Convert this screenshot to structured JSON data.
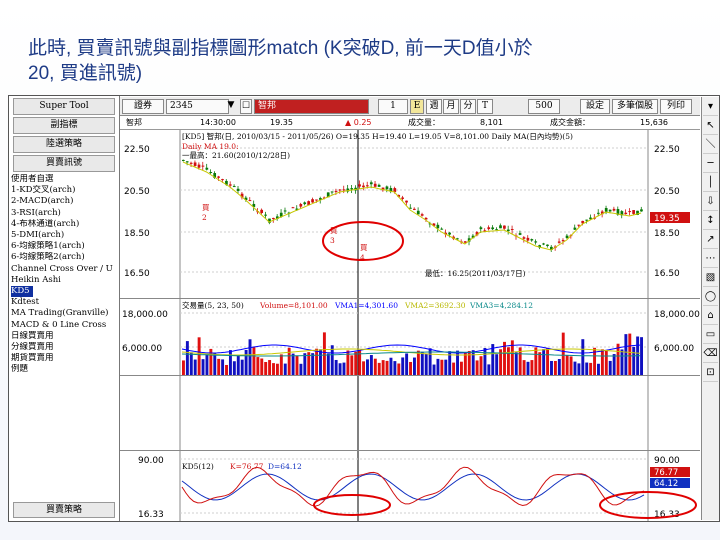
{
  "slide": {
    "title_line1": "此時, 買賣訊號與副指標圖形match (K突破D, 前一天D值小於",
    "title_line2": "20, 買進訊號)"
  },
  "sidebar": {
    "buttons": [
      "Super Tool",
      "副指標",
      "陸選策略",
      "買賣訊號"
    ],
    "list": [
      "使用者自選",
      "1-KD交叉(arch)",
      "2-MACD(arch)",
      "3-RSI(arch)",
      "4-布林通道(arch)",
      "5-DMI(arch)",
      "6-均線策略1(arch)",
      "6-均線策略2(arch)",
      "Channel Cross Over / U",
      "Heikin Ashi",
      "KD5",
      "Kdtest",
      "MA Trading(Granville)",
      "MACD & 0 Line Cross",
      "日線買賣用",
      "分線買賣用",
      "期貨買賣用",
      "例題"
    ],
    "selected_item": "KD5",
    "bottom_button": "買賣策略"
  },
  "toolbar": {
    "category": "證券",
    "code": "2345",
    "name": "智邦",
    "count": "1",
    "e_label": "E",
    "periods": [
      "週",
      "月",
      "分",
      "T"
    ],
    "bars": "500",
    "settings": "設定",
    "multi": "多筆個股",
    "print": "列印"
  },
  "infobar": {
    "name": "智邦",
    "time": "14:30:00",
    "price": "19.35",
    "change": "▲ 0.25",
    "volume_label": "成交量：",
    "volume": "8,101",
    "amount_label": "成交金額：",
    "amount": "15,636"
  },
  "price_panel": {
    "header": "[KD5]  智邦(日, 2010/03/15 - 2011/05/26)  O=19.35 H=19.40 L=19.05 V=8,101.00  Daily MA(日內均勢)(5)",
    "ma_label": "Daily MA 19.0:",
    "high_label": "一最高：21.60(2010/12/28日)",
    "low_label": "最低：16.25(2011/03/17日)",
    "buy_label_1": "買",
    "buy_num_1": "2",
    "buy_label_2": "買",
    "buy_num_2": "3",
    "buy_label_3": "買",
    "buy_num_3": "4",
    "y_ticks": [
      "22.50",
      "20.50",
      "18.50",
      "16.50"
    ],
    "last_price": "19.35",
    "colors": {
      "up": "#d01010",
      "down": "#0a7a0a",
      "ma": "#c8c800",
      "price_tag": "#d01010"
    }
  },
  "volume_panel": {
    "header_label": "交易量(5, 23, 50)",
    "volume": "Volume=8,101.00",
    "vma1": "VMA1=4,301.60",
    "vma2": "VMA2=3692.30",
    "vma3": "VMA3=4,284.12",
    "y_ticks": [
      "18,000.00",
      "6,000.00"
    ],
    "colors": {
      "up": "#e01010",
      "down": "#1010c0",
      "vma1": "#0000ff",
      "vma2": "#c8c800",
      "vma3": "#0a8a8a"
    }
  },
  "kd_panel": {
    "header_label": "KD5(12)",
    "k_value": "K=76.77",
    "d_value": "D=64.12",
    "y_ticks": [
      "90.00",
      "16.33"
    ],
    "k_tag": "76.77",
    "d_tag": "64.12",
    "colors": {
      "k": "#d01010",
      "d": "#1030c0",
      "highlight": "#e00000"
    }
  },
  "right_tools": [
    "▾",
    "↖",
    "＼",
    "─",
    "│",
    "⇩",
    "↕",
    "↗",
    "⋯",
    "▧",
    "◯",
    "⌂",
    "▭",
    "⌫",
    "⊡"
  ]
}
